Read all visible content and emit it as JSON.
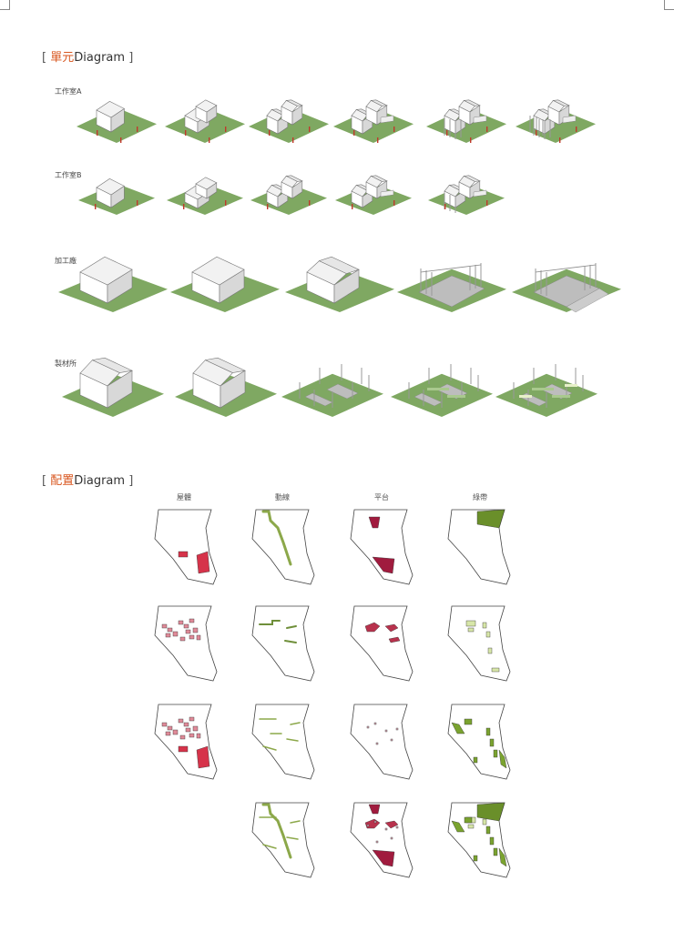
{
  "sections": {
    "unit": {
      "bracket_open": "[ ",
      "title_cn": "單元",
      "title_en": "Diagram",
      "bracket_close": " ]"
    },
    "layout": {
      "bracket_open": "[ ",
      "title_cn": "配置",
      "title_en": "Diagram",
      "bracket_close": " ]"
    }
  },
  "unit_rows": [
    {
      "label": "工作室A",
      "steps": 6
    },
    {
      "label": "工作室B",
      "steps": 5
    },
    {
      "label": "加工廠",
      "steps": 5
    },
    {
      "label": "製材所",
      "steps": 5
    }
  ],
  "layout_columns": [
    "屋體",
    "動線",
    "平台",
    "綠帶"
  ],
  "colors": {
    "accent": "#d8561f",
    "grass": "#7fa862",
    "grass_light": "#a9c98e",
    "building_top": "#f2f2f2",
    "building_left": "#ffffff",
    "building_right": "#d8d8d8",
    "paved": "#bdbdbd",
    "red_mass": "#d6334a",
    "pink_mass": "#e08a98",
    "maroon_platform": "#a01b3e",
    "path_green": "#8ca84a",
    "belt_green": "#6a8f2a",
    "belt_light": "#d7e6a8"
  }
}
